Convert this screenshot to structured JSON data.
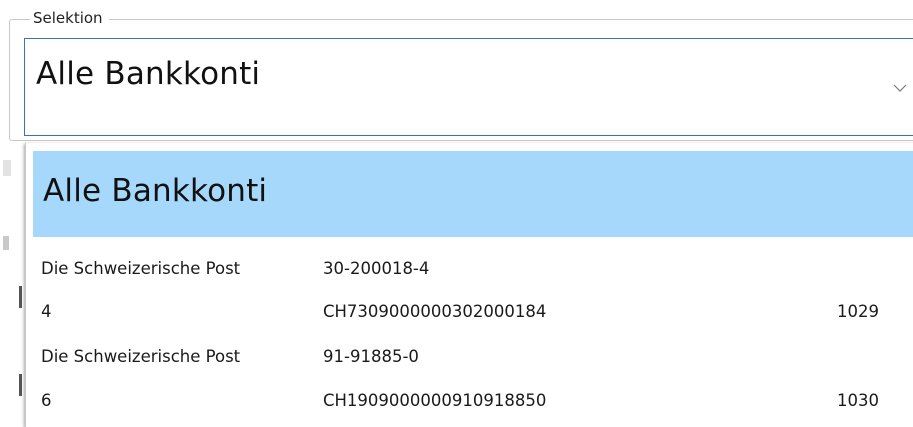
{
  "selection": {
    "group_label": "Selektion",
    "selected_value": "Alle Bankkonti"
  },
  "dropdown": {
    "options_header": "Alle Bankkonti",
    "accounts": [
      {
        "bank": "Die Schweizerische Post",
        "account_number": "30-200018-4",
        "id": "4",
        "iban": "CH7309000000302000184",
        "code": "1029"
      },
      {
        "bank": "Die Schweizerische Post",
        "account_number": "91-91885-0",
        "id": "6",
        "iban": "CH1909000000910918850",
        "code": "1030"
      }
    ]
  },
  "colors": {
    "highlight": "#a6d8fb",
    "combo_border": "#3f6fb5"
  },
  "icons": {
    "dropdown": "chevron-down-icon"
  }
}
